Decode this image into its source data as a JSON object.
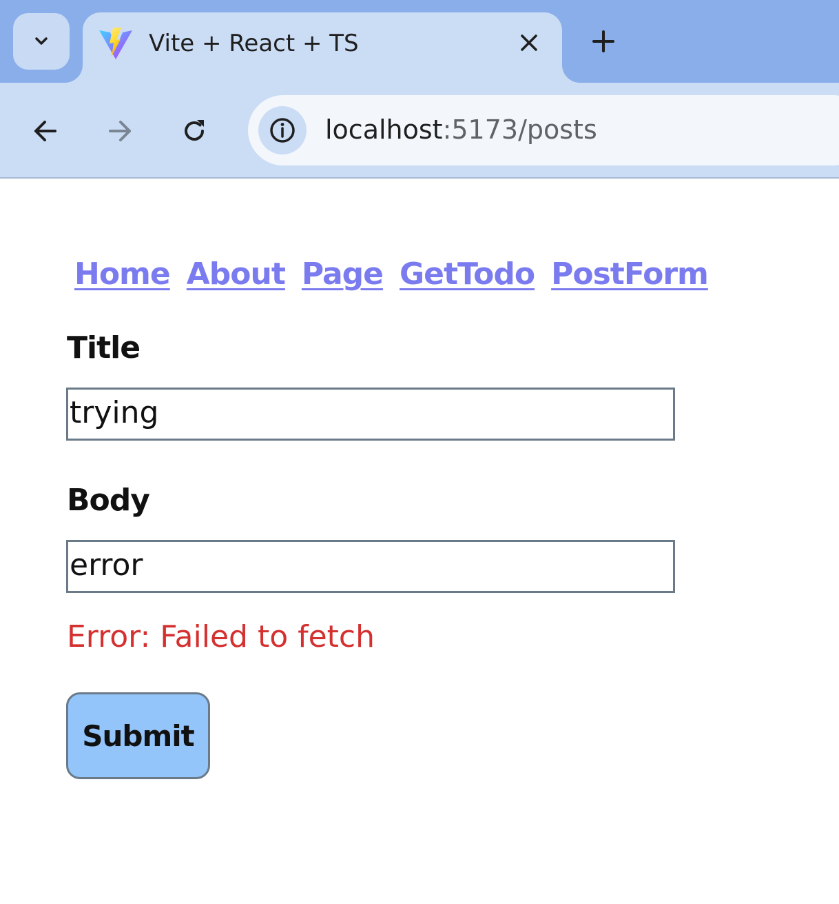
{
  "browser": {
    "tab": {
      "title": "Vite + React + TS",
      "favicon": "vite-logo-icon"
    },
    "address": {
      "host": "localhost",
      "rest": ":5173/posts"
    },
    "icons": {
      "tab_search": "chevron-down-icon",
      "close": "close-icon",
      "new_tab": "plus-icon",
      "back": "arrow-left-icon",
      "forward": "arrow-right-icon",
      "reload": "reload-icon",
      "site_info": "info-icon"
    },
    "colors": {
      "tabstrip": "#8aaeea",
      "toolbar": "#cbdcf5"
    }
  },
  "nav": {
    "links": [
      {
        "label": "Home"
      },
      {
        "label": "About"
      },
      {
        "label": "Page"
      },
      {
        "label": "GetTodo"
      },
      {
        "label": "PostForm"
      }
    ],
    "link_color": "#7b7bf0"
  },
  "form": {
    "title_label": "Title",
    "title_value": "trying",
    "body_label": "Body",
    "body_value": "error",
    "error_message": "Error: Failed to fetch",
    "submit_label": "Submit",
    "error_color": "#d43030",
    "submit_color": "#93c5fb"
  }
}
